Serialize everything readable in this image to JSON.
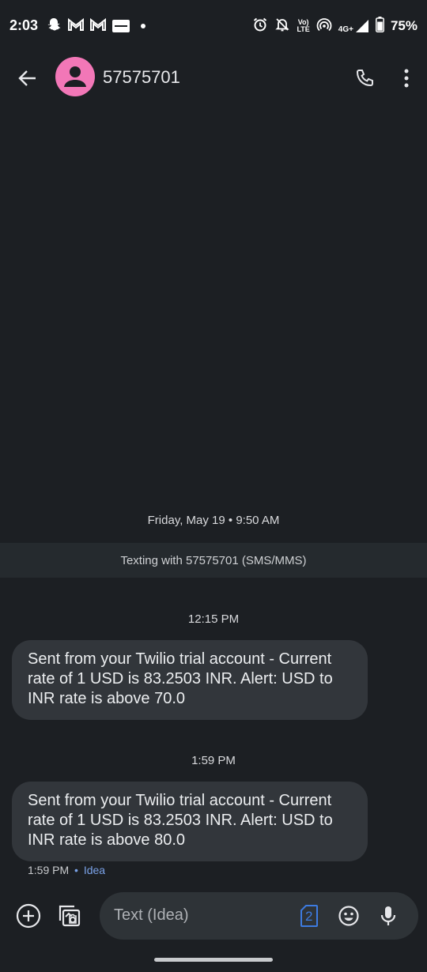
{
  "status_bar": {
    "time": "2:03",
    "battery": "75%",
    "network": "4G+",
    "volte_line1": "Vo)",
    "volte_line2": "LTE",
    "icons": [
      "snapchat-icon",
      "gmail-icon",
      "gmail-icon",
      "news-icon",
      "notification-dot",
      "alarm-icon",
      "mute-icon",
      "volte-icon",
      "hotspot-icon",
      "signal-icon",
      "battery-icon"
    ]
  },
  "header": {
    "contact_name": "57575701",
    "avatar_color": "#f277b7"
  },
  "conversation": {
    "date_header": "Friday, May 19 • 9:50 AM",
    "texting_banner": "Texting with 57575701 (SMS/MMS)",
    "messages": [
      {
        "time_separator": "12:15 PM",
        "text": "Sent from your Twilio trial account - Current rate of 1 USD is 83.2503 INR. Alert: USD to INR rate is above 70.0"
      },
      {
        "time_separator": "1:59 PM",
        "text": "Sent from your Twilio trial account - Current rate of 1 USD is 83.2503 INR. Alert: USD to INR rate is above 80.0",
        "meta_time": "1:59 PM",
        "meta_sep": "•",
        "carrier": "Idea"
      }
    ]
  },
  "compose": {
    "placeholder": "Text (Idea)",
    "sim_number": "2",
    "accent_color": "#3d7be0"
  }
}
